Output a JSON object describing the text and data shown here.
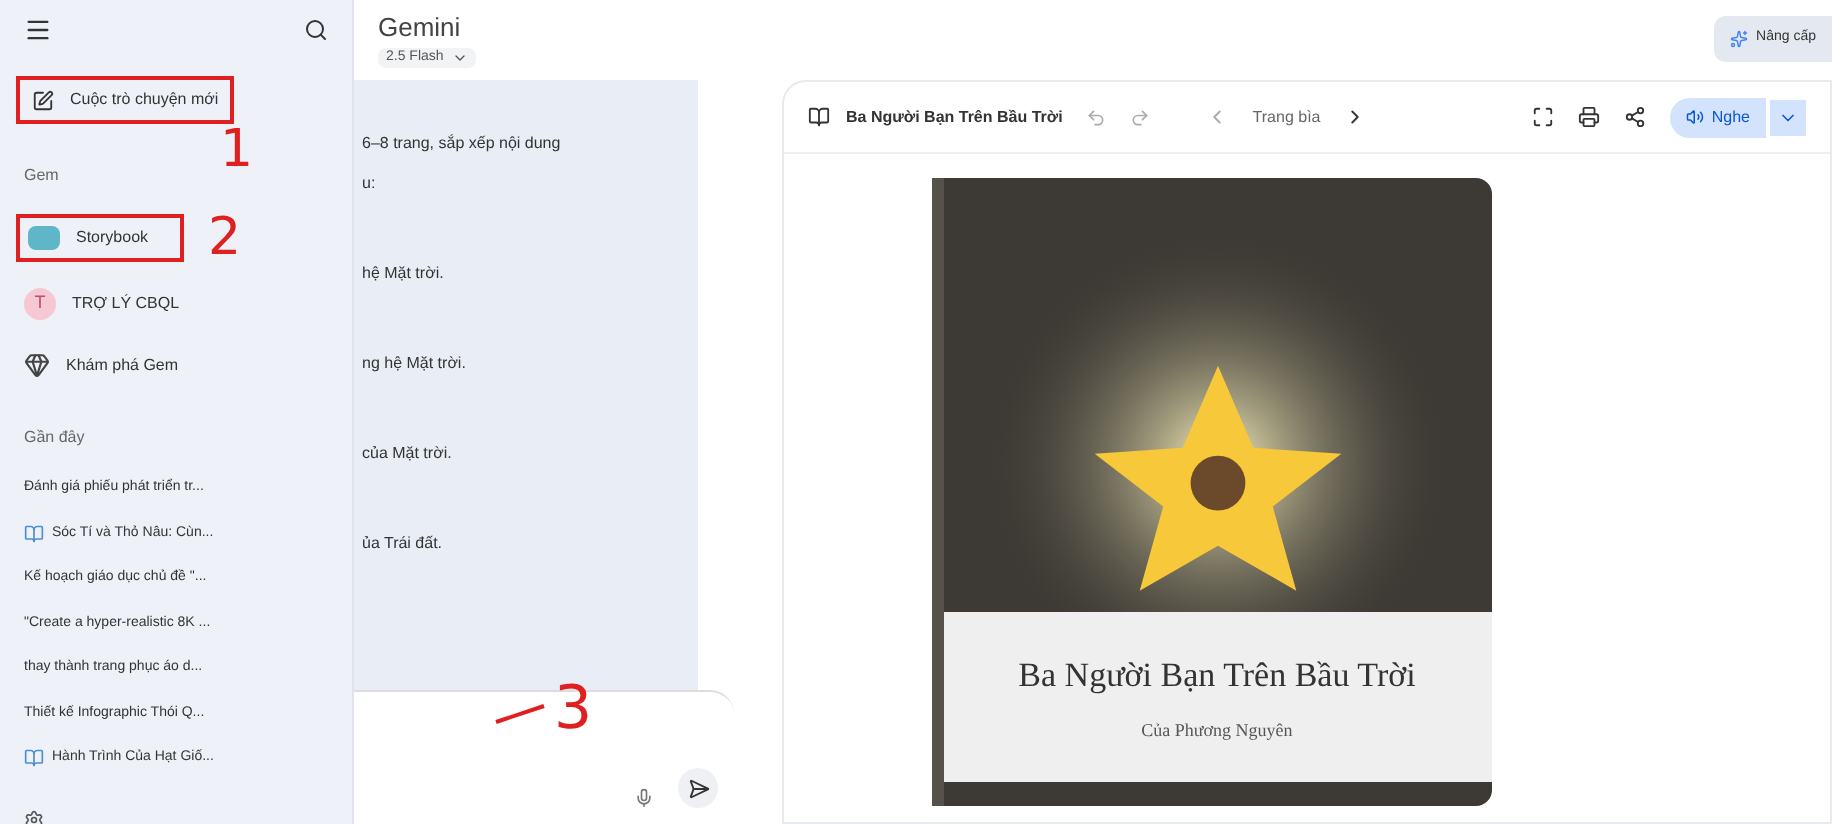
{
  "sidebar": {
    "new_chat": {
      "label": "Cuộc trò chuyện mới",
      "annotation": "1"
    },
    "gem_heading": "Gem",
    "gems": [
      {
        "label": "Storybook",
        "kind": "book",
        "annotation": "2"
      },
      {
        "label": "TRỢ LÝ CBQL",
        "kind": "letter",
        "letter": "T"
      },
      {
        "label": "Khám phá Gem",
        "kind": "explore"
      }
    ],
    "recent_heading": "Gần đây",
    "recent": [
      {
        "label": "Đánh giá phiếu phát triển tr...",
        "kind": "text"
      },
      {
        "label": "Sóc Tí và Thỏ Nâu: Cùn...",
        "kind": "book"
      },
      {
        "label": "Kế hoạch giáo dục chủ đề \"...",
        "kind": "text"
      },
      {
        "label": "\"Create a hyper-realistic 8K ...",
        "kind": "text"
      },
      {
        "label": "thay thành trang phục áo d...",
        "kind": "text"
      },
      {
        "label": "Thiết kế Infographic Thói Q...",
        "kind": "text"
      },
      {
        "label": "Hành Trình Của Hạt Giố...",
        "kind": "book"
      }
    ]
  },
  "header": {
    "title": "Gemini",
    "model": "2.5 Flash",
    "upgrade": "Nâng cấp"
  },
  "chat": {
    "lines": [
      "6–8 trang, sắp xếp nội dung",
      "u:",
      "hệ Mặt trời.",
      "ng hệ Mặt trời.",
      "của Mặt trời.",
      "ủa Trái đất."
    ],
    "input_annotation": "3"
  },
  "canvas": {
    "title": "Ba Người Bạn Trên Bầu Trời",
    "page": "Trang bìa",
    "listen": "Nghe",
    "cover": {
      "title": "Ba Người Bạn Trên Bầu Trời",
      "author": "Của Phương Nguyên"
    }
  }
}
